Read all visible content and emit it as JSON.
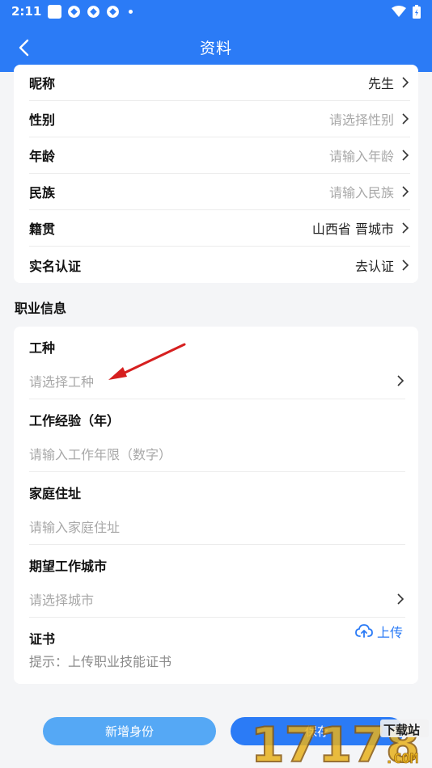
{
  "status": {
    "time": "2:11"
  },
  "header": {
    "title": "资料"
  },
  "profile": {
    "rows": [
      {
        "label": "昵称",
        "value": "先生",
        "placeholder": false
      },
      {
        "label": "性别",
        "value": "请选择性别",
        "placeholder": true
      },
      {
        "label": "年龄",
        "value": "请输入年龄",
        "placeholder": true
      },
      {
        "label": "民族",
        "value": "请输入民族",
        "placeholder": true
      },
      {
        "label": "籍贯",
        "value": "山西省 晋城市",
        "placeholder": false
      },
      {
        "label": "实名认证",
        "value": "去认证",
        "placeholder": false
      }
    ]
  },
  "career": {
    "section_title": "职业信息",
    "job_type": {
      "label": "工种",
      "placeholder": "请选择工种"
    },
    "experience": {
      "label": "工作经验（年）",
      "placeholder": "请输入工作年限（数字）"
    },
    "address": {
      "label": "家庭住址",
      "placeholder": "请输入家庭住址"
    },
    "city": {
      "label": "期望工作城市",
      "placeholder": "请选择城市"
    },
    "certificate": {
      "label": "证书",
      "upload_label": "上传",
      "hint": "提示：上传职业技能证书"
    }
  },
  "buttons": {
    "add_identity": "新增身份",
    "save": "保存"
  },
  "watermark": {
    "text": "17178",
    "sub": "下载站",
    "domain": ".COM"
  },
  "colors": {
    "primary": "#2b7bf6",
    "secondary": "#55a8f5",
    "annotation": "#d61f1f"
  }
}
